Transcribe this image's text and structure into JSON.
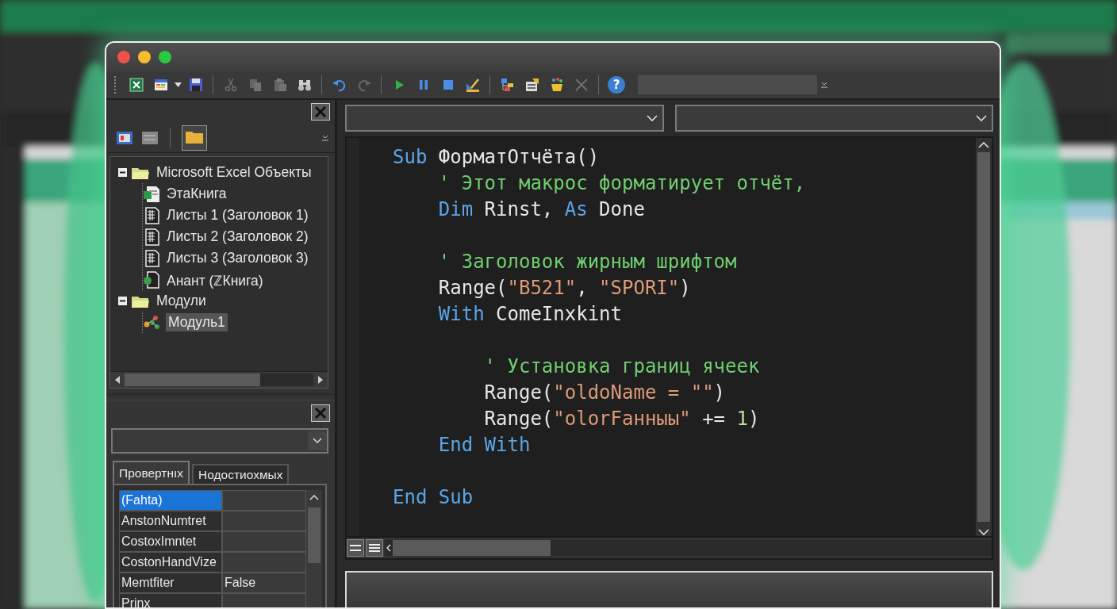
{
  "toolbar": [
    {
      "kind": "excel",
      "disabled": false
    },
    {
      "kind": "userform",
      "disabled": false
    },
    {
      "kind": "save",
      "disabled": false
    },
    {
      "kind": "separator"
    },
    {
      "kind": "cut",
      "disabled": true
    },
    {
      "kind": "copy",
      "disabled": true
    },
    {
      "kind": "paste",
      "disabled": true
    },
    {
      "kind": "find",
      "disabled": false
    },
    {
      "kind": "separator"
    },
    {
      "kind": "undo",
      "disabled": false
    },
    {
      "kind": "redo",
      "disabled": true
    },
    {
      "kind": "separator"
    },
    {
      "kind": "run",
      "disabled": false
    },
    {
      "kind": "pause",
      "disabled": false
    },
    {
      "kind": "stop",
      "disabled": false
    },
    {
      "kind": "design",
      "disabled": false
    },
    {
      "kind": "separator"
    },
    {
      "kind": "explorer",
      "disabled": false
    },
    {
      "kind": "properties",
      "disabled": false
    },
    {
      "kind": "browser",
      "disabled": false
    },
    {
      "kind": "toolbox",
      "disabled": true
    },
    {
      "kind": "separator"
    },
    {
      "kind": "help",
      "label": "?",
      "disabled": false
    }
  ],
  "project_explorer": {
    "tree": [
      {
        "label": "Microsoft Excel Объекты",
        "kind": "folder",
        "expanded": true,
        "selected": false,
        "children": [
          {
            "label": "ЭтаКнига",
            "kind": "workbook",
            "selected": false
          },
          {
            "label": "Листы 1 (Заголовок 1)",
            "kind": "sheet",
            "selected": false
          },
          {
            "label": "Листы 2 (Заголовок 2)",
            "kind": "sheet",
            "selected": false
          },
          {
            "label": "Листы 3 (Заголовок 3)",
            "kind": "sheet",
            "selected": false
          },
          {
            "label": "Анант (ℤКнига)",
            "kind": "document",
            "selected": false
          }
        ]
      },
      {
        "label": "Модули",
        "kind": "folder",
        "expanded": true,
        "selected": false,
        "children": [
          {
            "label": "Модуль1",
            "kind": "module",
            "selected": true
          }
        ]
      }
    ]
  },
  "properties": {
    "tabs": [
      {
        "label": "Провертнıх",
        "selected": true
      },
      {
        "label": "Нодостиохмых",
        "selected": false
      }
    ],
    "rows": [
      {
        "name": "(Fahta)",
        "selected": true
      },
      {
        "name": "AnstonNumtret",
        "selected": false
      },
      {
        "name": "CostoxImntet",
        "selected": false
      },
      {
        "name": "CostonHandVize",
        "selected": false
      },
      {
        "name": "Memtfiter",
        "value": "False",
        "selected": false
      },
      {
        "name": "Prinx",
        "selected": false
      }
    ]
  },
  "code": {
    "lines": [
      {
        "kind": "code",
        "tokens": [
          {
            "text": "Sub",
            "kind": "keyword"
          },
          {
            "text": " ФорматОтчёта()",
            "kind": "plain"
          }
        ]
      },
      {
        "kind": "code",
        "tokens": [
          {
            "text": "    ' Этот макрос форматирует отчёт,",
            "kind": "comment"
          }
        ]
      },
      {
        "kind": "code",
        "tokens": [
          {
            "text": "    Dim",
            "kind": "keyword"
          },
          {
            "text": " Rinst, ",
            "kind": "plain"
          },
          {
            "text": "As",
            "kind": "keyword"
          },
          {
            "text": " Done",
            "kind": "plain"
          }
        ]
      },
      {
        "kind": "blank"
      },
      {
        "kind": "code",
        "tokens": [
          {
            "text": "    ' Заголовок жирным шрифтом",
            "kind": "comment"
          }
        ]
      },
      {
        "kind": "code",
        "tokens": [
          {
            "text": "    Range(",
            "kind": "plain"
          },
          {
            "text": "\"B521\"",
            "kind": "string"
          },
          {
            "text": ", ",
            "kind": "plain"
          },
          {
            "text": "\"SPORI\"",
            "kind": "string"
          },
          {
            "text": ")",
            "kind": "plain"
          }
        ]
      },
      {
        "kind": "code",
        "tokens": [
          {
            "text": "    With",
            "kind": "keyword"
          },
          {
            "text": " ComeInxkint",
            "kind": "plain"
          }
        ]
      },
      {
        "kind": "blank"
      },
      {
        "kind": "code",
        "tokens": [
          {
            "text": "        ' Установка границ ячеек",
            "kind": "comment"
          }
        ]
      },
      {
        "kind": "code",
        "tokens": [
          {
            "text": "        Range(",
            "kind": "plain"
          },
          {
            "text": "\"oldoName = \"\"",
            "kind": "string"
          },
          {
            "text": ")",
            "kind": "plain"
          }
        ]
      },
      {
        "kind": "code",
        "tokens": [
          {
            "text": "        Range(",
            "kind": "plain"
          },
          {
            "text": "\"olorFанныы\"",
            "kind": "string"
          },
          {
            "text": " += ",
            "kind": "plain"
          },
          {
            "text": "1",
            "kind": "number"
          },
          {
            "text": ")",
            "kind": "plain"
          }
        ]
      },
      {
        "kind": "code",
        "tokens": [
          {
            "text": "    End With",
            "kind": "keyword"
          }
        ]
      },
      {
        "kind": "blank"
      },
      {
        "kind": "code",
        "tokens": [
          {
            "text": "End Sub",
            "kind": "keyword"
          }
        ]
      }
    ]
  }
}
